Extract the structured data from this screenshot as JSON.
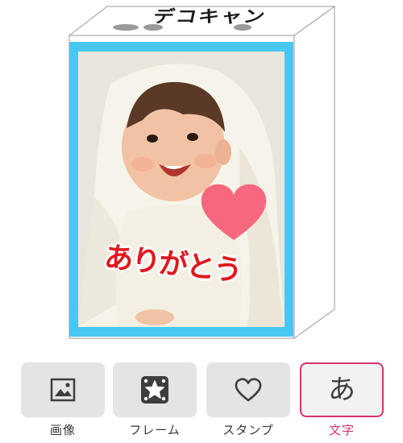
{
  "preview": {
    "brand_logo": "デコキャン",
    "caption": "ありがとう",
    "frame_color": "#48c7f2",
    "caption_color": "#e0191e",
    "heart_color": "#f7687e",
    "photo_subject": "baby-in-white-hooded-towel"
  },
  "toolbar": {
    "accent_color": "#d6336c",
    "tools": [
      {
        "label": "画像",
        "icon": "image-icon",
        "active": false
      },
      {
        "label": "フレーム",
        "icon": "frame-star-icon",
        "active": false
      },
      {
        "label": "スタンプ",
        "icon": "heart-outline-icon",
        "active": false
      },
      {
        "label": "文字",
        "icon": "moji-icon",
        "glyph": "あ",
        "active": true
      }
    ]
  }
}
